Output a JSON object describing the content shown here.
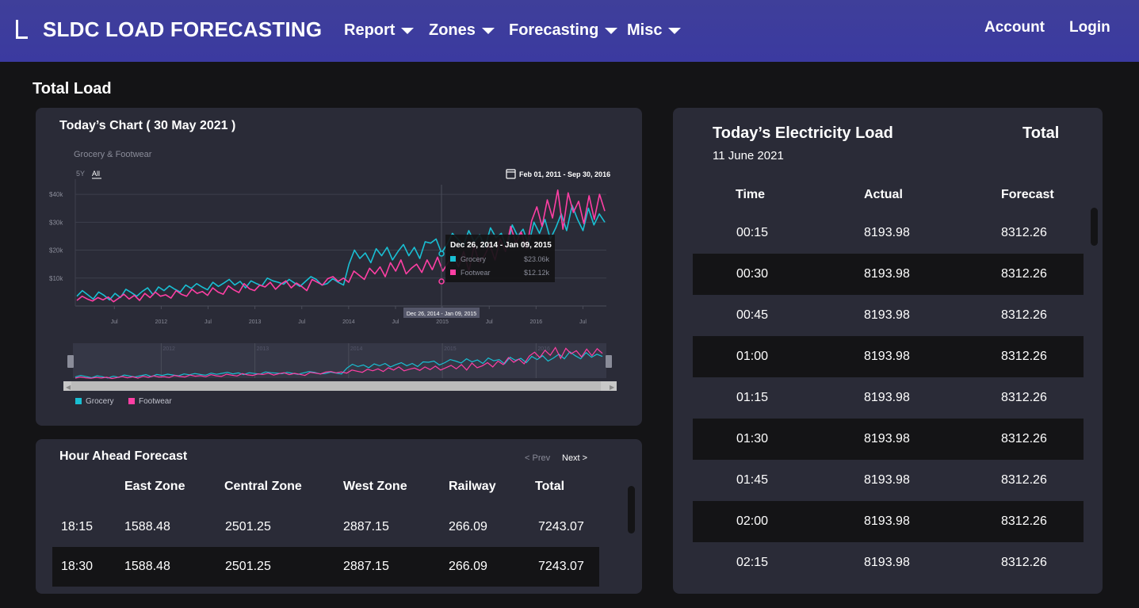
{
  "nav": {
    "brand": "SLDC LOAD FORECASTING",
    "menus": [
      "Report",
      "Zones",
      "Forecasting",
      "Misc"
    ],
    "account": "Account",
    "login": "Login"
  },
  "page": {
    "title": "Total Load"
  },
  "chart_card": {
    "title": "Today’s Chart ( 30 May 2021 )"
  },
  "chart_data": {
    "type": "line",
    "title": "Grocery & Footwear",
    "range_buttons": [
      "5Y",
      "All"
    ],
    "selected_range": "All",
    "date_range_label": "Feb 01, 2011 - Sep 30, 2016",
    "y_ticks": [
      "$10k",
      "$20k",
      "$30k",
      "$40k"
    ],
    "x_ticks": [
      "Jul",
      "2012",
      "Jul",
      "2013",
      "Jul",
      "2014",
      "Jul",
      "2015",
      "Jul",
      "2016",
      "Jul"
    ],
    "navigator_ticks": [
      "2012",
      "2013",
      "2014",
      "2015",
      "2016"
    ],
    "ylim": [
      0,
      44000
    ],
    "x_start": "2011-02",
    "series": [
      {
        "name": "Grocery",
        "color": "#19bfd3",
        "values": [
          3500,
          5500,
          4000,
          2500,
          5000,
          3800,
          2200,
          4500,
          3000,
          6000,
          4800,
          3500,
          5200,
          6500,
          4000,
          6800,
          5500,
          7200,
          6000,
          5000,
          7500,
          6300,
          8000,
          6800,
          5800,
          8500,
          7000,
          8200,
          9500,
          7500,
          8800,
          6500,
          9000,
          8000,
          7200,
          10000,
          9000,
          8500,
          7800,
          9500,
          8200,
          7000,
          8800,
          10500,
          9500,
          7500,
          8000,
          9800,
          8500,
          7500,
          15000,
          20000,
          17000,
          19000,
          15500,
          20500,
          18000,
          21000,
          16500,
          19500,
          22000,
          18000,
          21000,
          17000,
          23000,
          22500,
          24000,
          19000,
          22000,
          26000,
          24000,
          21500,
          27000,
          23000,
          25500,
          21000,
          28000,
          24500,
          26000,
          20500,
          29000,
          25000,
          27500,
          22000,
          30000,
          26000,
          31000,
          24000,
          28000,
          33000,
          27000,
          36000,
          31000,
          27000,
          35000,
          29000,
          33000,
          30000
        ]
      },
      {
        "name": "Footwear",
        "color": "#ff3fa4",
        "values": [
          2000,
          3500,
          2500,
          1800,
          3000,
          2200,
          3200,
          1500,
          2800,
          4200,
          2500,
          3800,
          2000,
          4500,
          3000,
          5000,
          3500,
          4000,
          2800,
          5500,
          4200,
          3500,
          6000,
          4500,
          5200,
          3800,
          6500,
          5000,
          4200,
          7200,
          5800,
          4800,
          8000,
          6200,
          5500,
          7500,
          6800,
          8500,
          6000,
          7800,
          9000,
          6500,
          8200,
          7000,
          5500,
          9500,
          8500,
          7500,
          9800,
          10500,
          8800,
          10000,
          8500,
          12500,
          11000,
          9500,
          13500,
          11500,
          14000,
          10500,
          15500,
          12500,
          16500,
          11500,
          13500,
          15000,
          12000,
          16500,
          13000,
          17500,
          12500,
          15500,
          18500,
          14000,
          19500,
          12500,
          21500,
          15500,
          18000,
          22000,
          16500,
          24000,
          19500,
          28500,
          22500,
          26500,
          20500,
          30500,
          35500,
          28500,
          38000,
          31500,
          41500,
          27500,
          40500,
          33500,
          37500,
          29500,
          39500,
          31000,
          40000,
          34000
        ]
      }
    ],
    "tooltip": {
      "title": "Dec 26, 2014 - Jan 09, 2015",
      "rows": [
        {
          "name": "Grocery",
          "value": "$23.06k"
        },
        {
          "name": "Footwear",
          "value": "$12.12k"
        }
      ]
    },
    "crosshair_label": "Dec 26, 2014 - Jan 09, 2015",
    "legend": [
      "Grocery",
      "Footwear"
    ]
  },
  "hourly": {
    "title": "Hour Ahead Forecast",
    "prev": "< Prev",
    "next": "Next >",
    "headers": [
      "East Zone",
      "Central Zone",
      "West Zone",
      "Railway",
      "Total"
    ],
    "rows": [
      {
        "time": "18:15",
        "east": "1588.48",
        "central": "2501.25",
        "west": "2887.15",
        "railway": "266.09",
        "total": "7243.07"
      },
      {
        "time": "18:30",
        "east": "1588.48",
        "central": "2501.25",
        "west": "2887.15",
        "railway": "266.09",
        "total": "7243.07"
      }
    ]
  },
  "electricity": {
    "title": "Today’s Electricity Load",
    "total_label": "Total",
    "date": "11 June 2021",
    "headers": [
      "Time",
      "Actual",
      "Forecast"
    ],
    "rows": [
      {
        "time": "00:15",
        "actual": "8193.98",
        "forecast": "8312.26"
      },
      {
        "time": "00:30",
        "actual": "8193.98",
        "forecast": "8312.26"
      },
      {
        "time": "00:45",
        "actual": "8193.98",
        "forecast": "8312.26"
      },
      {
        "time": "01:00",
        "actual": "8193.98",
        "forecast": "8312.26"
      },
      {
        "time": "01:15",
        "actual": "8193.98",
        "forecast": "8312.26"
      },
      {
        "time": "01:30",
        "actual": "8193.98",
        "forecast": "8312.26"
      },
      {
        "time": "01:45",
        "actual": "8193.98",
        "forecast": "8312.26"
      },
      {
        "time": "02:00",
        "actual": "8193.98",
        "forecast": "8312.26"
      },
      {
        "time": "02:15",
        "actual": "8193.98",
        "forecast": "8312.26"
      }
    ]
  }
}
